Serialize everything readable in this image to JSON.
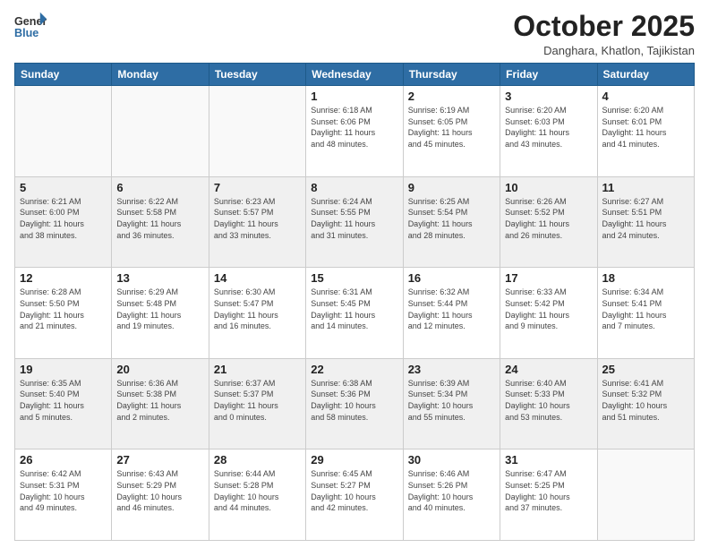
{
  "logo": {
    "general": "General",
    "blue": "Blue"
  },
  "header": {
    "month": "October 2025",
    "location": "Danghara, Khatlon, Tajikistan"
  },
  "weekdays": [
    "Sunday",
    "Monday",
    "Tuesday",
    "Wednesday",
    "Thursday",
    "Friday",
    "Saturday"
  ],
  "weeks": [
    [
      {
        "day": "",
        "info": ""
      },
      {
        "day": "",
        "info": ""
      },
      {
        "day": "",
        "info": ""
      },
      {
        "day": "1",
        "info": "Sunrise: 6:18 AM\nSunset: 6:06 PM\nDaylight: 11 hours\nand 48 minutes."
      },
      {
        "day": "2",
        "info": "Sunrise: 6:19 AM\nSunset: 6:05 PM\nDaylight: 11 hours\nand 45 minutes."
      },
      {
        "day": "3",
        "info": "Sunrise: 6:20 AM\nSunset: 6:03 PM\nDaylight: 11 hours\nand 43 minutes."
      },
      {
        "day": "4",
        "info": "Sunrise: 6:20 AM\nSunset: 6:01 PM\nDaylight: 11 hours\nand 41 minutes."
      }
    ],
    [
      {
        "day": "5",
        "info": "Sunrise: 6:21 AM\nSunset: 6:00 PM\nDaylight: 11 hours\nand 38 minutes."
      },
      {
        "day": "6",
        "info": "Sunrise: 6:22 AM\nSunset: 5:58 PM\nDaylight: 11 hours\nand 36 minutes."
      },
      {
        "day": "7",
        "info": "Sunrise: 6:23 AM\nSunset: 5:57 PM\nDaylight: 11 hours\nand 33 minutes."
      },
      {
        "day": "8",
        "info": "Sunrise: 6:24 AM\nSunset: 5:55 PM\nDaylight: 11 hours\nand 31 minutes."
      },
      {
        "day": "9",
        "info": "Sunrise: 6:25 AM\nSunset: 5:54 PM\nDaylight: 11 hours\nand 28 minutes."
      },
      {
        "day": "10",
        "info": "Sunrise: 6:26 AM\nSunset: 5:52 PM\nDaylight: 11 hours\nand 26 minutes."
      },
      {
        "day": "11",
        "info": "Sunrise: 6:27 AM\nSunset: 5:51 PM\nDaylight: 11 hours\nand 24 minutes."
      }
    ],
    [
      {
        "day": "12",
        "info": "Sunrise: 6:28 AM\nSunset: 5:50 PM\nDaylight: 11 hours\nand 21 minutes."
      },
      {
        "day": "13",
        "info": "Sunrise: 6:29 AM\nSunset: 5:48 PM\nDaylight: 11 hours\nand 19 minutes."
      },
      {
        "day": "14",
        "info": "Sunrise: 6:30 AM\nSunset: 5:47 PM\nDaylight: 11 hours\nand 16 minutes."
      },
      {
        "day": "15",
        "info": "Sunrise: 6:31 AM\nSunset: 5:45 PM\nDaylight: 11 hours\nand 14 minutes."
      },
      {
        "day": "16",
        "info": "Sunrise: 6:32 AM\nSunset: 5:44 PM\nDaylight: 11 hours\nand 12 minutes."
      },
      {
        "day": "17",
        "info": "Sunrise: 6:33 AM\nSunset: 5:42 PM\nDaylight: 11 hours\nand 9 minutes."
      },
      {
        "day": "18",
        "info": "Sunrise: 6:34 AM\nSunset: 5:41 PM\nDaylight: 11 hours\nand 7 minutes."
      }
    ],
    [
      {
        "day": "19",
        "info": "Sunrise: 6:35 AM\nSunset: 5:40 PM\nDaylight: 11 hours\nand 5 minutes."
      },
      {
        "day": "20",
        "info": "Sunrise: 6:36 AM\nSunset: 5:38 PM\nDaylight: 11 hours\nand 2 minutes."
      },
      {
        "day": "21",
        "info": "Sunrise: 6:37 AM\nSunset: 5:37 PM\nDaylight: 11 hours\nand 0 minutes."
      },
      {
        "day": "22",
        "info": "Sunrise: 6:38 AM\nSunset: 5:36 PM\nDaylight: 10 hours\nand 58 minutes."
      },
      {
        "day": "23",
        "info": "Sunrise: 6:39 AM\nSunset: 5:34 PM\nDaylight: 10 hours\nand 55 minutes."
      },
      {
        "day": "24",
        "info": "Sunrise: 6:40 AM\nSunset: 5:33 PM\nDaylight: 10 hours\nand 53 minutes."
      },
      {
        "day": "25",
        "info": "Sunrise: 6:41 AM\nSunset: 5:32 PM\nDaylight: 10 hours\nand 51 minutes."
      }
    ],
    [
      {
        "day": "26",
        "info": "Sunrise: 6:42 AM\nSunset: 5:31 PM\nDaylight: 10 hours\nand 49 minutes."
      },
      {
        "day": "27",
        "info": "Sunrise: 6:43 AM\nSunset: 5:29 PM\nDaylight: 10 hours\nand 46 minutes."
      },
      {
        "day": "28",
        "info": "Sunrise: 6:44 AM\nSunset: 5:28 PM\nDaylight: 10 hours\nand 44 minutes."
      },
      {
        "day": "29",
        "info": "Sunrise: 6:45 AM\nSunset: 5:27 PM\nDaylight: 10 hours\nand 42 minutes."
      },
      {
        "day": "30",
        "info": "Sunrise: 6:46 AM\nSunset: 5:26 PM\nDaylight: 10 hours\nand 40 minutes."
      },
      {
        "day": "31",
        "info": "Sunrise: 6:47 AM\nSunset: 5:25 PM\nDaylight: 10 hours\nand 37 minutes."
      },
      {
        "day": "",
        "info": ""
      }
    ]
  ]
}
